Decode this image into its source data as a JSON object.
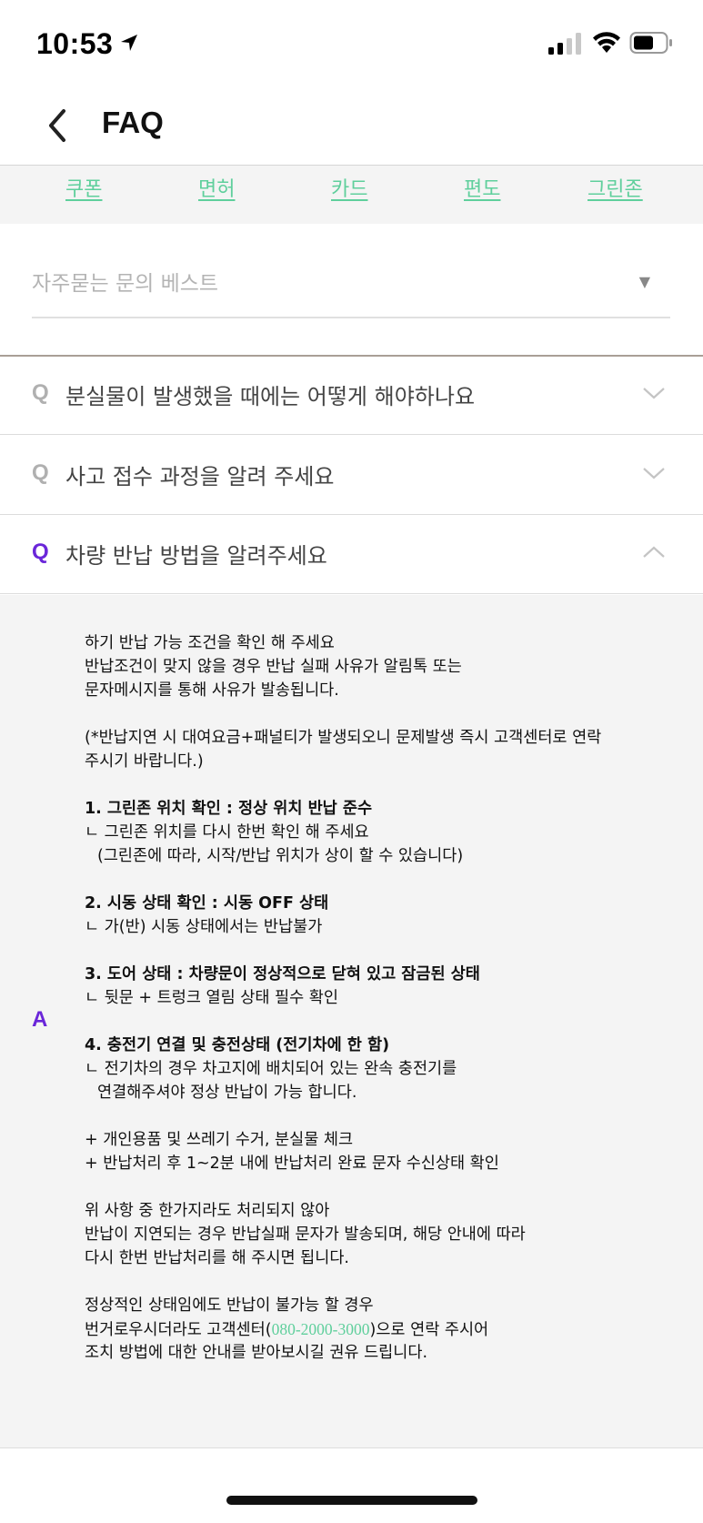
{
  "status_bar": {
    "time": "10:53"
  },
  "header": {
    "title": "FAQ"
  },
  "categories": [
    "쿠폰",
    "면허",
    "카드",
    "편도",
    "그린존"
  ],
  "dropdown": {
    "selected": "자주묻는 문의 베스트"
  },
  "faqs": [
    {
      "question": "분실물이 발생했을 때에는 어떻게 해야하나요",
      "expanded": false
    },
    {
      "question": "사고 접수 과정을 알려 주세요",
      "expanded": false
    },
    {
      "question": "차량 반납 방법을 알려주세요",
      "expanded": true
    }
  ],
  "labels": {
    "q": "Q",
    "a": "A"
  },
  "answer": {
    "intro_1": "하기 반납 가능 조건을 확인 해 주세요",
    "intro_2": "반납조건이 맞지 않을 경우 반납 실패 사유가 알림톡 또는",
    "intro_3": "문자메시지를 통해 사유가 발송됩니다.",
    "note_1": "(*반납지연 시 대여요금+패널티가 발생되오니 문제발생 즉시 고객센터로 연락",
    "note_2": "주시기 바랍니다.)",
    "s1_title": "1. 그린존 위치 확인 : 정상 위치 반납 준수",
    "s1_line1": "ㄴ 그린존 위치를 다시 한번 확인 해 주세요",
    "s1_line2": "(그린존에 따라, 시작/반납 위치가 상이 할 수 있습니다)",
    "s2_title": "2. 시동 상태  확인 : 시동 OFF 상태",
    "s2_line1": "ㄴ 가(반) 시동 상태에서는 반납불가",
    "s3_title": "3. 도어 상태 : 차량문이 정상적으로 닫혀 있고 잠금된 상태",
    "s3_line1": "ㄴ 뒷문 + 트렁크 열림 상태 필수 확인",
    "s4_title": "4. 충전기 연결 및 충전상태 (전기차에 한 함)",
    "s4_line1": "ㄴ 전기차의 경우 차고지에 배치되어 있는 완속 충전기를",
    "s4_line2": "연결해주셔야 정상 반납이 가능 합니다.",
    "extra_1": "+ 개인용품 및 쓰레기 수거, 분실물 체크",
    "extra_2": "+ 반납처리 후 1~2분 내에 반납처리 완료 문자 수신상태 확인",
    "retry_1": "위 사항 중 한가지라도 처리되지 않아",
    "retry_2": "반납이 지연되는 경우 반납실패 문자가 발송되며, 해당 안내에 따라",
    "retry_3": "다시 한번 반납처리를 해 주시면 됩니다.",
    "contact_1": "정상적인 상태임에도 반납이 불가능 할 경우",
    "contact_2_pre": "번거로우시더라도 고객센터(",
    "contact_phone": "080-2000-3000",
    "contact_2_post": ")으로 연락 주시어",
    "contact_3": "조치 방법에 대한 안내를 받아보시길 권유 드립니다."
  },
  "colors": {
    "accent_purple": "#6a26d9",
    "category_green": "#5fcf9c",
    "answer_bg": "#f4f4f4"
  }
}
